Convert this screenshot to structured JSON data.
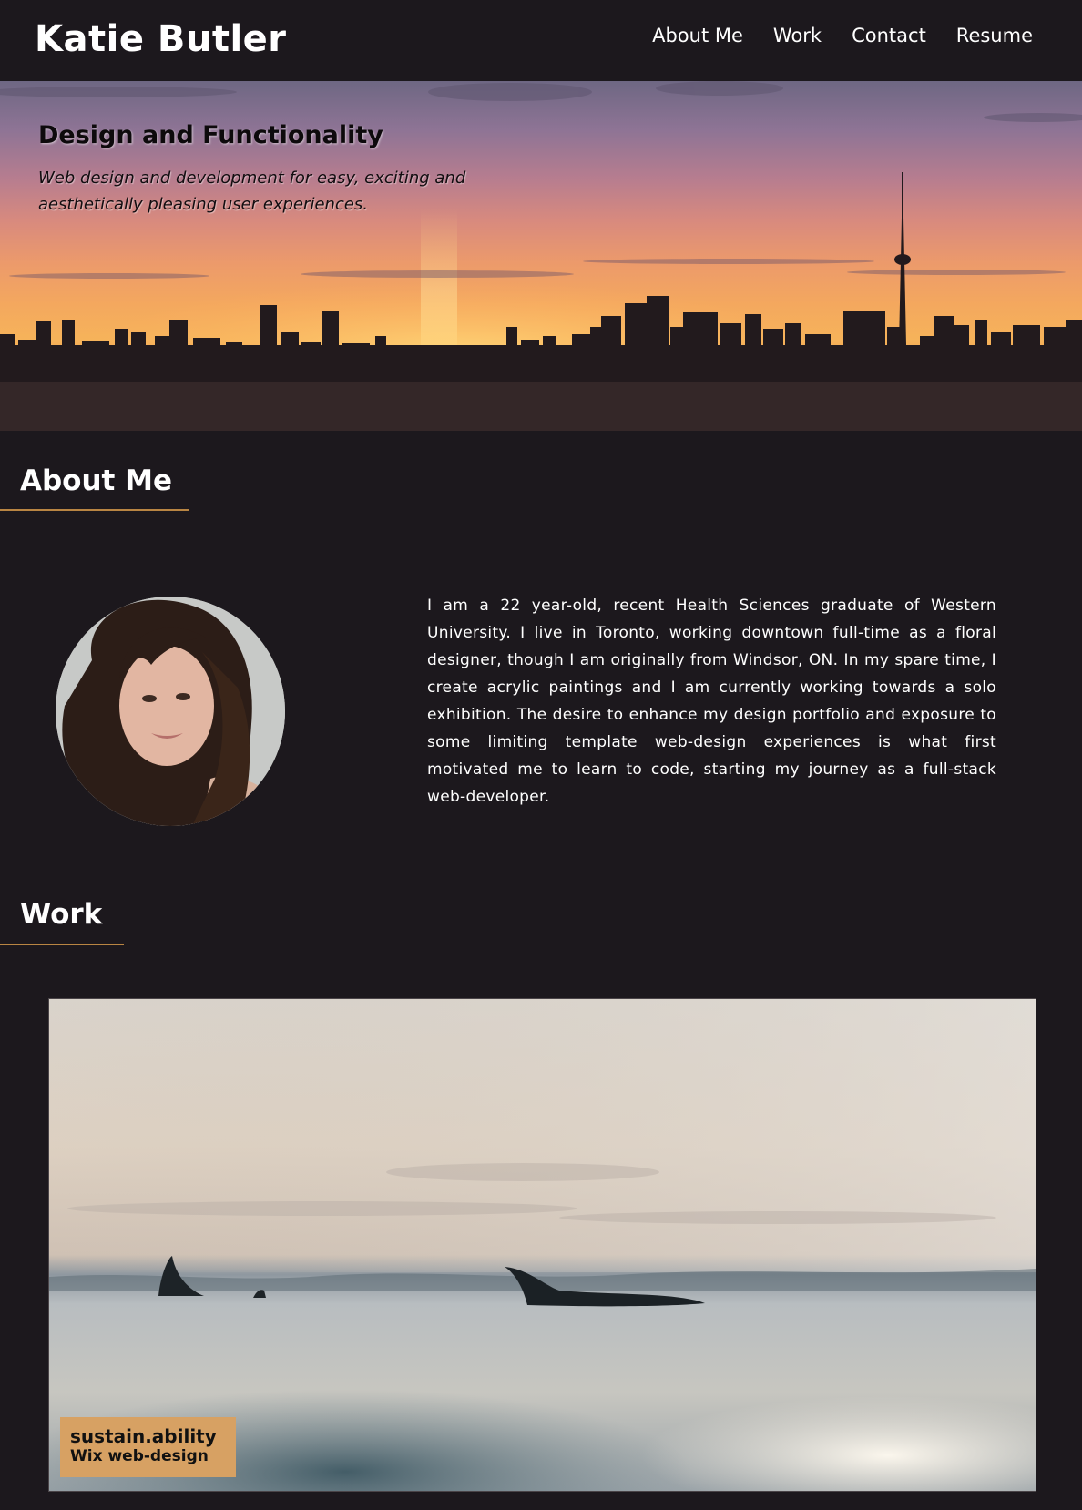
{
  "header": {
    "brand": "Katie Butler",
    "nav": [
      "About Me",
      "Work",
      "Contact",
      "Resume"
    ]
  },
  "hero": {
    "title": "Design and Functionality",
    "subtitle": "Web design and development for easy, exciting and aesthetically pleasing user experiences."
  },
  "about": {
    "heading": "About Me",
    "bio": "I am a 22 year-old, recent Health Sciences graduate of Western University. I live in Toronto, working downtown full-time as a floral designer, though I am originally from Windsor, ON. In my spare time, I create acrylic paintings and I am currently working towards a solo exhibition. The desire to enhance my design portfolio and exposure to some limiting template web-design experiences is what first motivated me to learn to code, starting my journey as a full-stack web-developer."
  },
  "work": {
    "heading": "Work",
    "projects": [
      {
        "title": "sustain.ability",
        "subtitle": "Wix web-design"
      }
    ]
  },
  "colors": {
    "background": "#1c181d",
    "accent_rule": "#b98543",
    "label_bg": "#d7a163"
  }
}
